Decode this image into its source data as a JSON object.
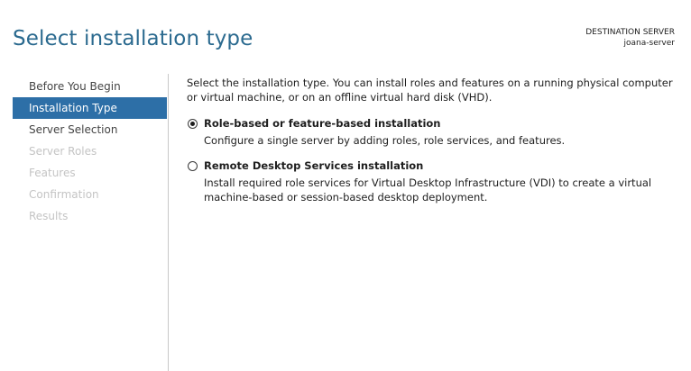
{
  "header": {
    "title": "Select installation type",
    "destination_label": "DESTINATION SERVER",
    "destination_server": "joana-server"
  },
  "sidebar": {
    "items": [
      {
        "label": "Before You Begin",
        "state": "enabled"
      },
      {
        "label": "Installation Type",
        "state": "active"
      },
      {
        "label": "Server Selection",
        "state": "enabled"
      },
      {
        "label": "Server Roles",
        "state": "disabled"
      },
      {
        "label": "Features",
        "state": "disabled"
      },
      {
        "label": "Confirmation",
        "state": "disabled"
      },
      {
        "label": "Results",
        "state": "disabled"
      }
    ]
  },
  "main": {
    "intro": "Select the installation type. You can install roles and features on a running physical computer or virtual machine, or on an offline virtual hard disk (VHD).",
    "options": [
      {
        "label": "Role-based or feature-based installation",
        "description": "Configure a single server by adding roles, role services, and features.",
        "selected": true
      },
      {
        "label": "Remote Desktop Services installation",
        "description": "Install required role services for Virtual Desktop Infrastructure (VDI) to create a virtual machine-based or session-based desktop deployment.",
        "selected": false
      }
    ]
  },
  "colors": {
    "title": "#2b6a8f",
    "active_nav_bg": "#2d6fa7",
    "disabled_nav_text": "#c4c4c4"
  }
}
